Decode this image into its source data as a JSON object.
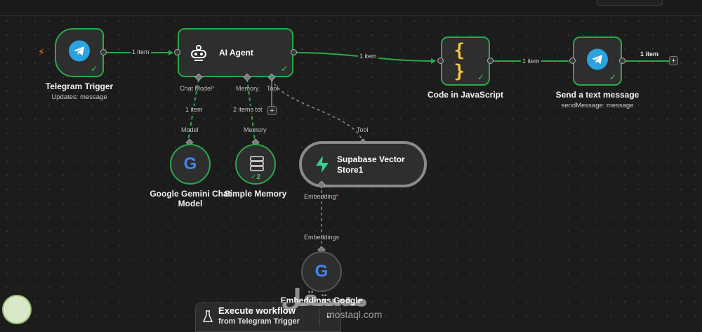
{
  "nodes": {
    "telegram_trigger": {
      "title": "Telegram Trigger",
      "subtitle": "Updates: message"
    },
    "ai_agent": {
      "title": "AI Agent"
    },
    "code": {
      "title": "Code in JavaScript"
    },
    "send_message": {
      "title": "Send a text message",
      "subtitle": "sendMessage: message"
    },
    "gemini": {
      "title_line1": "Google Gemini Chat",
      "title_line2": "Model"
    },
    "memory": {
      "title": "Simple Memory",
      "check_count": "2"
    },
    "supabase": {
      "title_line1": "Supabase Vector",
      "title_line2": "Store1"
    },
    "embeddings": {
      "title": "Embeddings Google"
    }
  },
  "connections": {
    "trigger_to_agent": "1 item",
    "agent_to_code": "1 item",
    "code_to_send": "1 item",
    "send_output": "1 item",
    "chat_model_count": "1 item",
    "memory_count": "2 items tot"
  },
  "ports": {
    "chat_model": "Chat Model",
    "chat_model_req": "*",
    "memory": "Memory",
    "tool": "Tool",
    "model": "Model",
    "memory_in": "Memory",
    "tool_in": "Tool",
    "embedding": "Embedding",
    "embedding_req": "*",
    "embeddings_in": "Embeddings"
  },
  "execute": {
    "label": "Execute workflow",
    "sub": "from Telegram Trigger"
  },
  "watermark": {
    "text": "مستقل",
    "url": "mostaql.com"
  },
  "colors": {
    "success": "#2aa84a",
    "canvas": "#1c1c1c",
    "telegram": "#2aa3e0",
    "supabase": "#3ecf8e"
  }
}
